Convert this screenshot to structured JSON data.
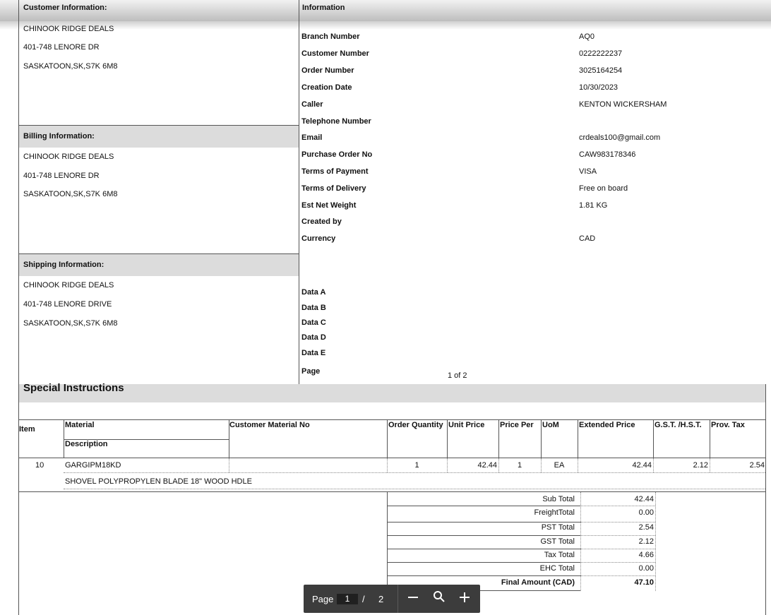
{
  "sections": {
    "customer_info": "Customer Information:",
    "information": "Information",
    "billing_info": "Billing Information:",
    "shipping_info": "Shipping Information:",
    "special_instructions": "Special Instructions"
  },
  "customer": {
    "name": "CHINOOK RIDGE DEALS",
    "street": " 401-748 LENORE DR",
    "city": "SASKATOON,SK,S7K 6M8"
  },
  "billing": {
    "name": "CHINOOK RIDGE DEALS",
    "street": " 401-748 LENORE DR",
    "city": "SASKATOON,SK,S7K 6M8"
  },
  "shipping": {
    "name": "CHINOOK RIDGE DEALS",
    "street": " 401-748 LENORE DRIVE",
    "city": "SASKATOON,SK,S7K 6M8"
  },
  "info": {
    "branch_label": "Branch Number",
    "branch_value": "AQ0",
    "customer_no_label": "Customer Number",
    "customer_no_value": "0222222237",
    "order_no_label": "Order Number",
    "order_no_value": "3025164254",
    "creation_label": "Creation Date",
    "creation_value": "10/30/2023",
    "caller_label": "Caller",
    "caller_value": "KENTON WICKERSHAM",
    "tel_label": "Telephone Number",
    "tel_value": "",
    "email_label": "Email",
    "email_value": "crdeals100@gmail.com",
    "po_label": "Purchase Order No",
    "po_value": "CAW983178346",
    "terms_payment_label": "Terms of Payment",
    "terms_payment_value": "VISA",
    "terms_delivery_label": "Terms of Delivery",
    "terms_delivery_value": "Free on board",
    "weight_label": "Est Net Weight",
    "weight_value": "1.81 KG",
    "created_by_label": "Created by",
    "created_by_value": "",
    "currency_label": "Currency",
    "currency_value": "CAD",
    "data_a": "Data A",
    "data_b": "Data B",
    "data_c": "Data C",
    "data_d": "Data D",
    "data_e": "Data E",
    "page_label": "Page",
    "page_value": "1 of 2"
  },
  "table": {
    "headers": {
      "item": "Item",
      "material": "Material",
      "description": "Description",
      "customer_material_no": "Customer Material No",
      "order_quantity": "Order Quantity",
      "unit_price": "Unit Price",
      "price_per": "Price Per",
      "uom": "UoM",
      "extended_price": "Extended Price",
      "gst": "G.S.T. /H.S.T.",
      "prov_tax": "Prov. Tax"
    },
    "row": {
      "item": "10",
      "material": "GARGIPM18KD",
      "description": "SHOVEL POLYPROPYLEN BLADE 18\" WOOD HDLE",
      "customer_material_no": "",
      "order_quantity": "1",
      "unit_price": "42.44",
      "price_per": "1",
      "uom": "EA",
      "extended_price": "42.44",
      "gst": "2.12",
      "prov_tax": "2.54"
    }
  },
  "totals": [
    {
      "label": "Sub Total",
      "value": "42.44"
    },
    {
      "label": "FreightTotal",
      "value": "0.00"
    },
    {
      "label": "PST Total",
      "value": "2.54"
    },
    {
      "label": "GST Total",
      "value": "2.12"
    },
    {
      "label": "Tax Total",
      "value": "4.66"
    },
    {
      "label": "EHC Total",
      "value": "0.00"
    },
    {
      "label": "Final Amount (CAD)",
      "value": "47.10"
    }
  ],
  "toolbar": {
    "page_label": "Page",
    "current_page": "1",
    "separator": "/",
    "total_pages": "2"
  }
}
